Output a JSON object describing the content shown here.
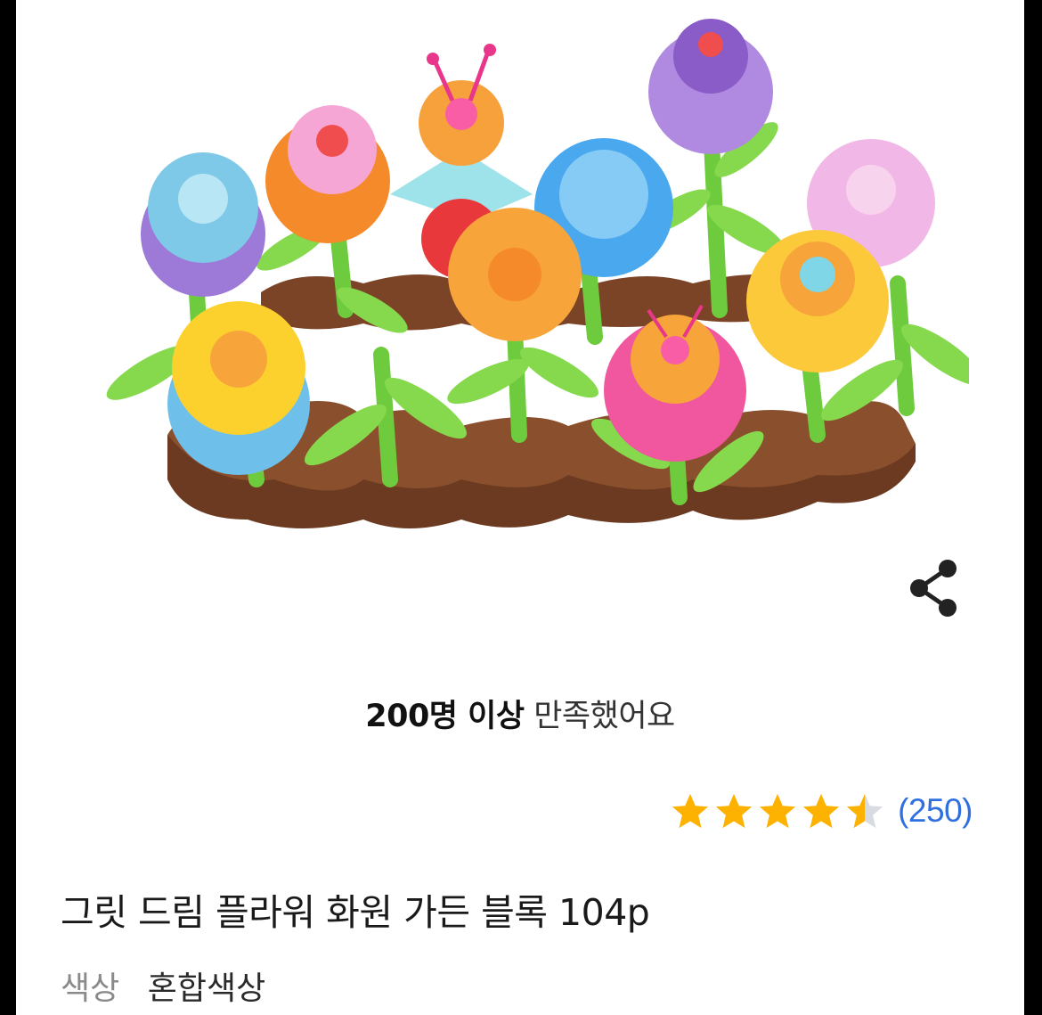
{
  "product": {
    "image_alt": "flower-garden-block-toy",
    "title": "그릿 드림 플라워 화원 가든 블록 104p"
  },
  "satisfaction": {
    "strong": "200명 이상",
    "rest": "만족했어요"
  },
  "rating": {
    "value": 4.5,
    "max": 5,
    "review_count": "(250)",
    "star_color": "#FDB100",
    "star_empty_color": "#D8DCE2"
  },
  "options": {
    "label": "색상",
    "value": "혼합색상"
  },
  "icons": {
    "share": "share-icon"
  }
}
